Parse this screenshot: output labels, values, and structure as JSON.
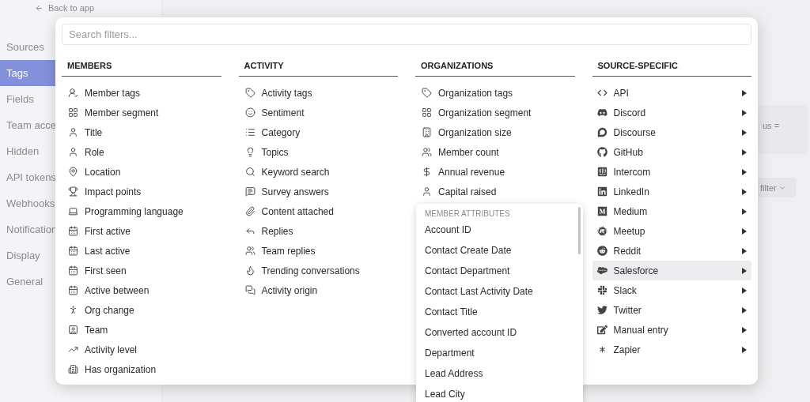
{
  "back_link": "Back to app",
  "sidebar": {
    "items": [
      {
        "label": "Sources",
        "selected": false
      },
      {
        "label": "Tags",
        "selected": true
      },
      {
        "label": "Fields",
        "selected": false
      },
      {
        "label": "Team acce",
        "selected": false
      },
      {
        "label": "Hidden",
        "selected": false
      },
      {
        "label": "API tokens",
        "selected": false
      },
      {
        "label": "Webhooks",
        "selected": false
      },
      {
        "label": "Notification",
        "selected": false
      },
      {
        "label": "Display",
        "selected": false
      },
      {
        "label": "General",
        "selected": false
      }
    ]
  },
  "background": {
    "card_text": "us =",
    "filter_button": "filter"
  },
  "filter_menu": {
    "search": {
      "placeholder": "Search filters..."
    },
    "columns": [
      {
        "title": "MEMBERS",
        "items": [
          "Member tags",
          "Member segment",
          "Title",
          "Role",
          "Location",
          "Impact points",
          "Programming language",
          "First active",
          "Last active",
          "First seen",
          "Active between",
          "Org change",
          "Team",
          "Activity level",
          "Has organization"
        ]
      },
      {
        "title": "ACTIVITY",
        "items": [
          "Activity tags",
          "Sentiment",
          "Category",
          "Topics",
          "Keyword search",
          "Survey answers",
          "Content attached",
          "Replies",
          "Team replies",
          "Trending conversations",
          "Activity origin"
        ]
      },
      {
        "title": "ORGANIZATIONS",
        "items": [
          "Organization tags",
          "Organization segment",
          "Organization size",
          "Member count",
          "Annual revenue",
          "Capital raised"
        ]
      }
    ],
    "sources": {
      "title": "SOURCE-SPECIFIC",
      "items": [
        {
          "label": "API",
          "selected": false
        },
        {
          "label": "Discord",
          "selected": false
        },
        {
          "label": "Discourse",
          "selected": false
        },
        {
          "label": "GitHub",
          "selected": false
        },
        {
          "label": "Intercom",
          "selected": false
        },
        {
          "label": "LinkedIn",
          "selected": false
        },
        {
          "label": "Medium",
          "selected": false
        },
        {
          "label": "Meetup",
          "selected": false
        },
        {
          "label": "Reddit",
          "selected": false
        },
        {
          "label": "Salesforce",
          "selected": true
        },
        {
          "label": "Slack",
          "selected": false
        },
        {
          "label": "Twitter",
          "selected": false
        },
        {
          "label": "Manual entry",
          "selected": false
        },
        {
          "label": "Zapier",
          "selected": false
        }
      ]
    }
  },
  "submenu": {
    "header": "MEMBER ATTRIBUTES",
    "items": [
      "Account ID",
      "Contact Create Date",
      "Contact Department",
      "Contact Last Activity Date",
      "Contact Title",
      "Converted account ID",
      "Department",
      "Lead Address",
      "Lead City"
    ]
  }
}
